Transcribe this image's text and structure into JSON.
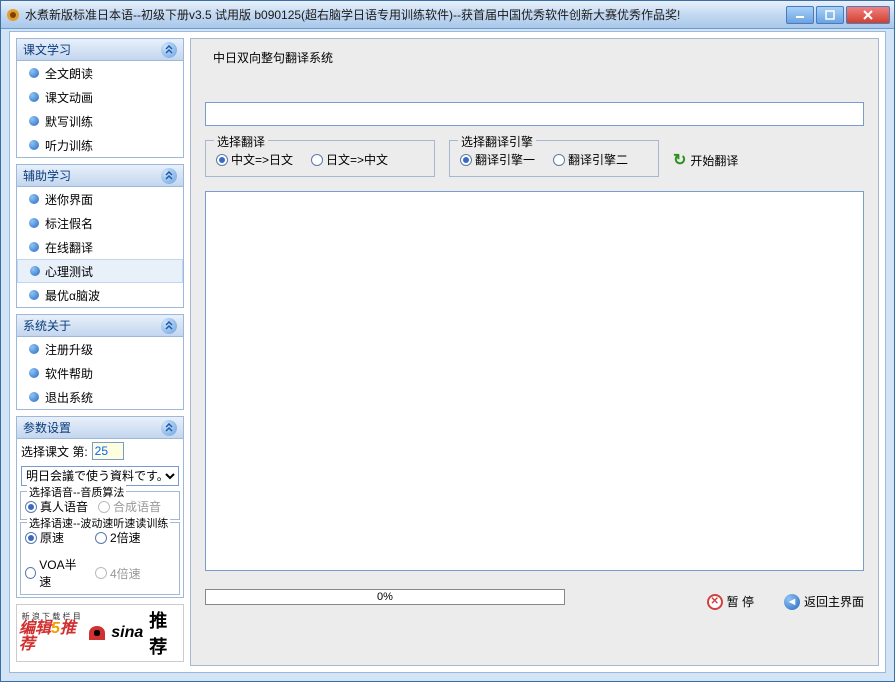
{
  "window": {
    "title": "水煮新版标准日本语--初级下册v3.5 试用版 b090125(超右脑学日语专用训练软件)--获首届中国优秀软件创新大赛优秀作品奖!"
  },
  "sidebar": {
    "sections": [
      {
        "title": "课文学习",
        "items": [
          "全文朗读",
          "课文动画",
          "默写训练",
          "听力训练"
        ]
      },
      {
        "title": "辅助学习",
        "items": [
          "迷你界面",
          "标注假名",
          "在线翻译",
          "心理测试",
          "最优α脑波"
        ]
      },
      {
        "title": "系统关于",
        "items": [
          "注册升级",
          "软件帮助",
          "退出系统"
        ]
      }
    ],
    "selected": "心理测试",
    "params": {
      "title": "参数设置",
      "lessonLabel": "选择课文  第:",
      "lessonValue": "25",
      "lessonDropdown": "明日会議で使う資料です。",
      "voiceGroup": {
        "legend": "选择语音--音质算法",
        "options": [
          "真人语音",
          "合成语音"
        ],
        "selected": "真人语音",
        "disabled": [
          "合成语音"
        ]
      },
      "speedGroup": {
        "legend": "选择语速--波动速听速读训练",
        "options": [
          "原速",
          "2倍速",
          "VOA半速",
          "4倍速"
        ],
        "selected": "原速",
        "disabled": [
          "4倍速"
        ]
      }
    },
    "sina": {
      "top": "新 浪 下 载 栏 目",
      "brand1": "编辑",
      "num": "5",
      "brand2": "推荐",
      "logo": "sina",
      "rec": "推荐"
    }
  },
  "main": {
    "title": "中日双向整句翻译系统",
    "directionGroup": {
      "legend": "选择翻译",
      "options": [
        "中文=>日文",
        "日文=>中文"
      ],
      "selected": "中文=>日文"
    },
    "engineGroup": {
      "legend": "选择翻译引擎",
      "options": [
        "翻译引擎一",
        "翻译引擎二"
      ],
      "selected": "翻译引擎一"
    },
    "startBtn": "开始翻译",
    "pauseBtn": "暂 停",
    "backBtn": "返回主界面",
    "progress": "0%"
  }
}
